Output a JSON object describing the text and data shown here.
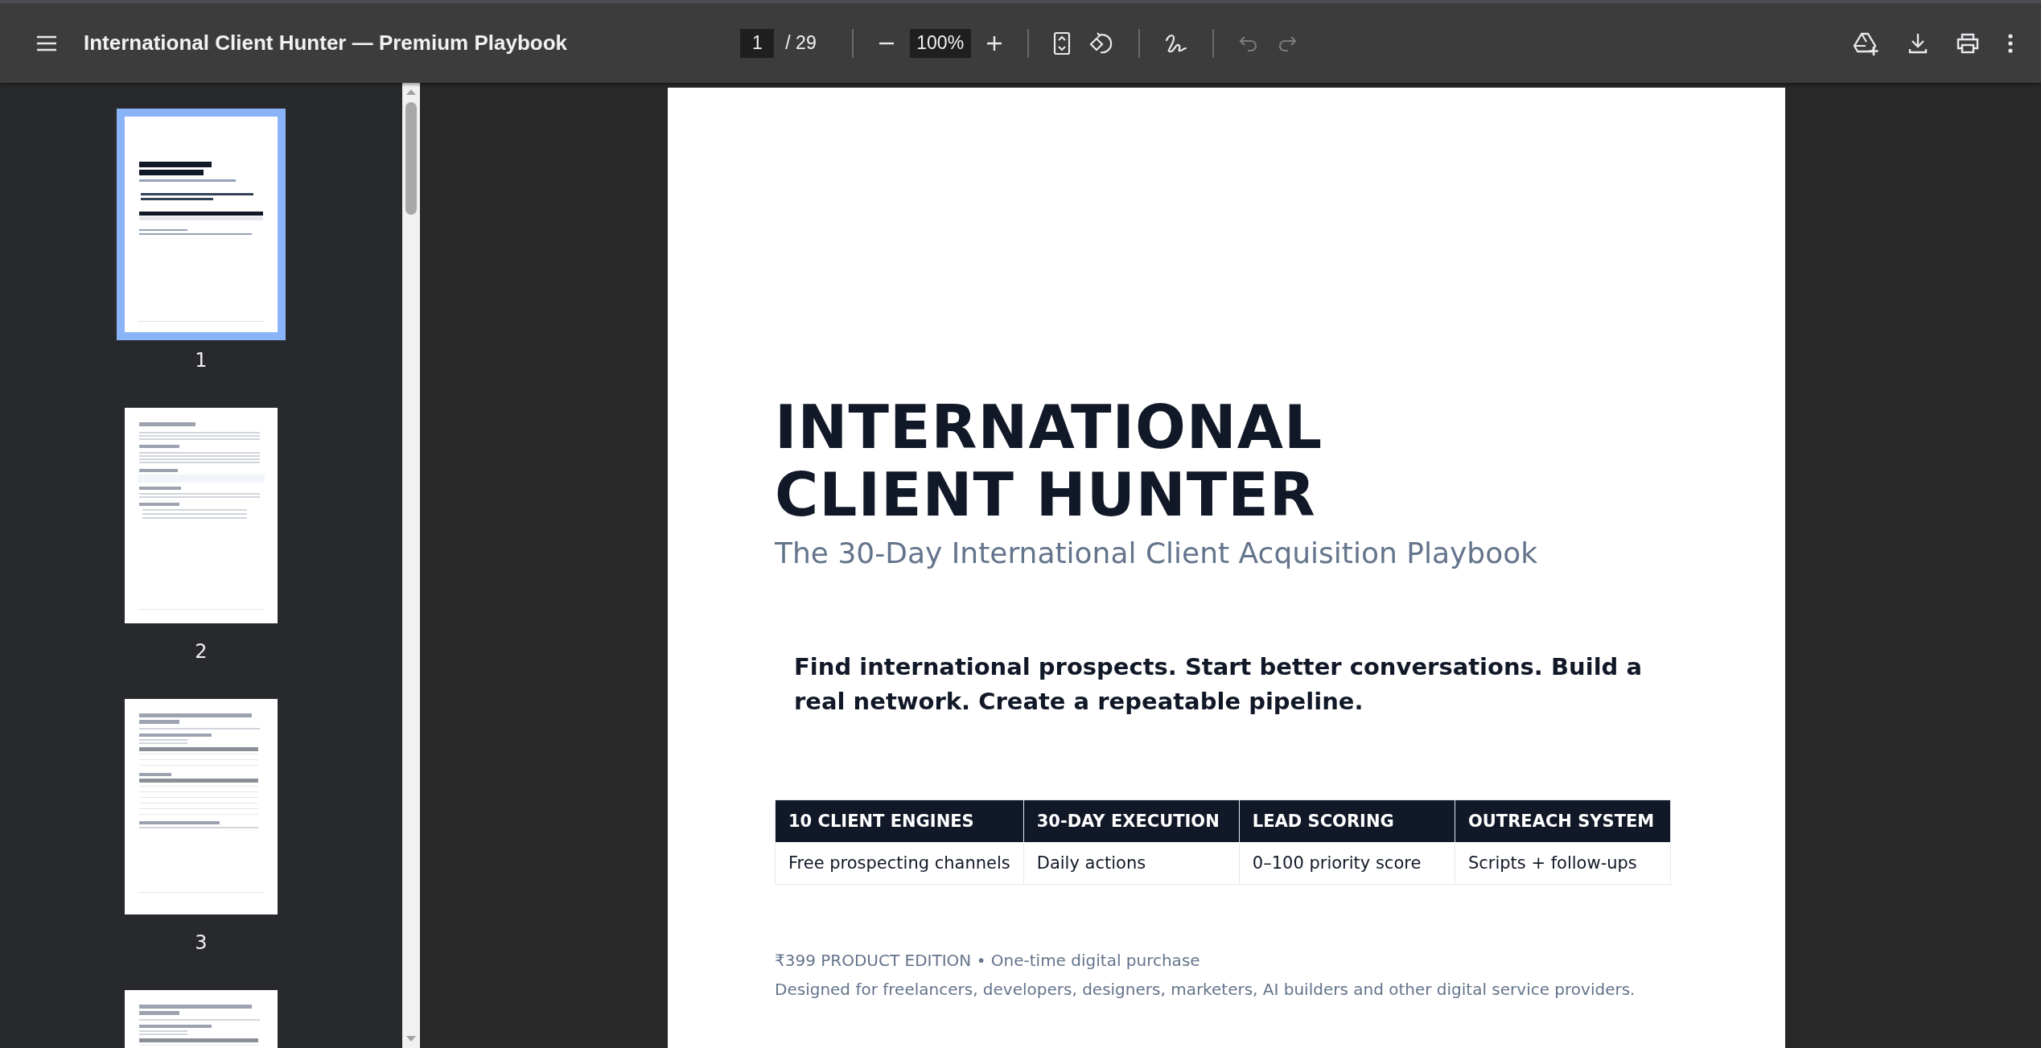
{
  "toolbar": {
    "title": "International Client Hunter — Premium Playbook",
    "page_input": "1",
    "page_count": "/ 29",
    "zoom": "100%",
    "history": [
      {
        "disabled": true
      },
      {
        "disabled": true
      }
    ]
  },
  "thumbnails": [
    {
      "label": "1",
      "selected": true,
      "kind": "cover"
    },
    {
      "label": "2",
      "selected": false,
      "kind": "text"
    },
    {
      "label": "3",
      "selected": false,
      "kind": "table"
    },
    {
      "selected": false,
      "kind": "table"
    }
  ],
  "document": {
    "title_lines": [
      "INTERNATIONAL",
      "CLIENT HUNTER"
    ],
    "subtitle": "The 30-Day International Client Acquisition Playbook",
    "tagline": "Find international prospects. Start better conversations. Build a real network. Create a repeatable pipeline.",
    "table": {
      "columns": [
        {
          "header": "10 CLIENT ENGINES",
          "cell": "Free prospecting channels"
        },
        {
          "header": "30-DAY EXECUTION",
          "cell": "Daily actions"
        },
        {
          "header": "LEAD SCORING",
          "cell": "0–100 priority score"
        },
        {
          "header": "OUTREACH SYSTEM",
          "cell": "Scripts + follow-ups"
        }
      ]
    },
    "footer_lines": [
      "₹399 PRODUCT EDITION • One-time digital purchase",
      "Designed for freelancers, developers, designers, marketers, AI builders and other digital service providers."
    ]
  }
}
